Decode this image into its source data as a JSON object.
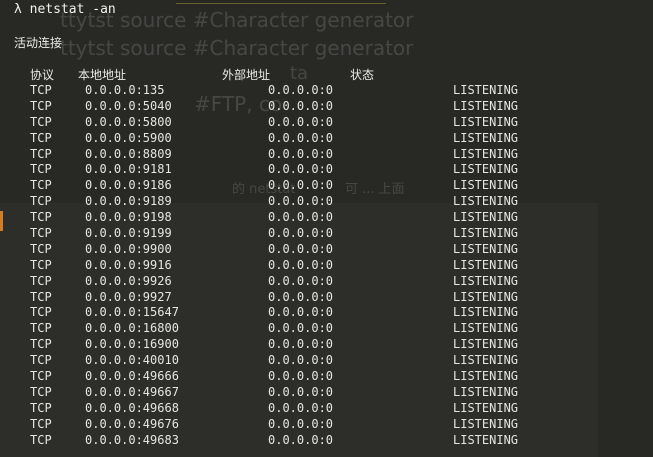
{
  "background_ghost": {
    "lines": [
      {
        "text": "ttytst source          #Character generator"
      },
      {
        "text": "ttytst source          #Character generator"
      },
      {
        "text": "ta"
      },
      {
        "text": "#FTP, co"
      },
      {
        "text": "的 netstat"
      },
      {
        "text": "可 ... 上面"
      }
    ]
  },
  "command": {
    "prompt": "λ",
    "text": "netstat -an"
  },
  "section_title": "活动连接",
  "headers": {
    "proto": "协议",
    "local": "本地地址",
    "foreign": "外部地址",
    "state": "状态"
  },
  "connections": [
    {
      "proto": "TCP",
      "local": "0.0.0.0:135",
      "foreign": "0.0.0.0:0",
      "state": "LISTENING"
    },
    {
      "proto": "TCP",
      "local": "0.0.0.0:5040",
      "foreign": "0.0.0.0:0",
      "state": "LISTENING"
    },
    {
      "proto": "TCP",
      "local": "0.0.0.0:5800",
      "foreign": "0.0.0.0:0",
      "state": "LISTENING"
    },
    {
      "proto": "TCP",
      "local": "0.0.0.0:5900",
      "foreign": "0.0.0.0:0",
      "state": "LISTENING"
    },
    {
      "proto": "TCP",
      "local": "0.0.0.0:8809",
      "foreign": "0.0.0.0:0",
      "state": "LISTENING"
    },
    {
      "proto": "TCP",
      "local": "0.0.0.0:9181",
      "foreign": "0.0.0.0:0",
      "state": "LISTENING"
    },
    {
      "proto": "TCP",
      "local": "0.0.0.0:9186",
      "foreign": "0.0.0.0:0",
      "state": "LISTENING"
    },
    {
      "proto": "TCP",
      "local": "0.0.0.0:9189",
      "foreign": "0.0.0.0:0",
      "state": "LISTENING"
    },
    {
      "proto": "TCP",
      "local": "0.0.0.0:9198",
      "foreign": "0.0.0.0:0",
      "state": "LISTENING"
    },
    {
      "proto": "TCP",
      "local": "0.0.0.0:9199",
      "foreign": "0.0.0.0:0",
      "state": "LISTENING"
    },
    {
      "proto": "TCP",
      "local": "0.0.0.0:9900",
      "foreign": "0.0.0.0:0",
      "state": "LISTENING"
    },
    {
      "proto": "TCP",
      "local": "0.0.0.0:9916",
      "foreign": "0.0.0.0:0",
      "state": "LISTENING"
    },
    {
      "proto": "TCP",
      "local": "0.0.0.0:9926",
      "foreign": "0.0.0.0:0",
      "state": "LISTENING"
    },
    {
      "proto": "TCP",
      "local": "0.0.0.0:9927",
      "foreign": "0.0.0.0:0",
      "state": "LISTENING"
    },
    {
      "proto": "TCP",
      "local": "0.0.0.0:15647",
      "foreign": "0.0.0.0:0",
      "state": "LISTENING"
    },
    {
      "proto": "TCP",
      "local": "0.0.0.0:16800",
      "foreign": "0.0.0.0:0",
      "state": "LISTENING"
    },
    {
      "proto": "TCP",
      "local": "0.0.0.0:16900",
      "foreign": "0.0.0.0:0",
      "state": "LISTENING"
    },
    {
      "proto": "TCP",
      "local": "0.0.0.0:40010",
      "foreign": "0.0.0.0:0",
      "state": "LISTENING"
    },
    {
      "proto": "TCP",
      "local": "0.0.0.0:49666",
      "foreign": "0.0.0.0:0",
      "state": "LISTENING"
    },
    {
      "proto": "TCP",
      "local": "0.0.0.0:49667",
      "foreign": "0.0.0.0:0",
      "state": "LISTENING"
    },
    {
      "proto": "TCP",
      "local": "0.0.0.0:49668",
      "foreign": "0.0.0.0:0",
      "state": "LISTENING"
    },
    {
      "proto": "TCP",
      "local": "0.0.0.0:49676",
      "foreign": "0.0.0.0:0",
      "state": "LISTENING"
    },
    {
      "proto": "TCP",
      "local": "0.0.0.0:49683",
      "foreign": "0.0.0.0:0",
      "state": "LISTENING"
    }
  ],
  "colors": {
    "background": "#282825",
    "text": "#e6e6e0",
    "accent_orange": "#d97a1e"
  }
}
